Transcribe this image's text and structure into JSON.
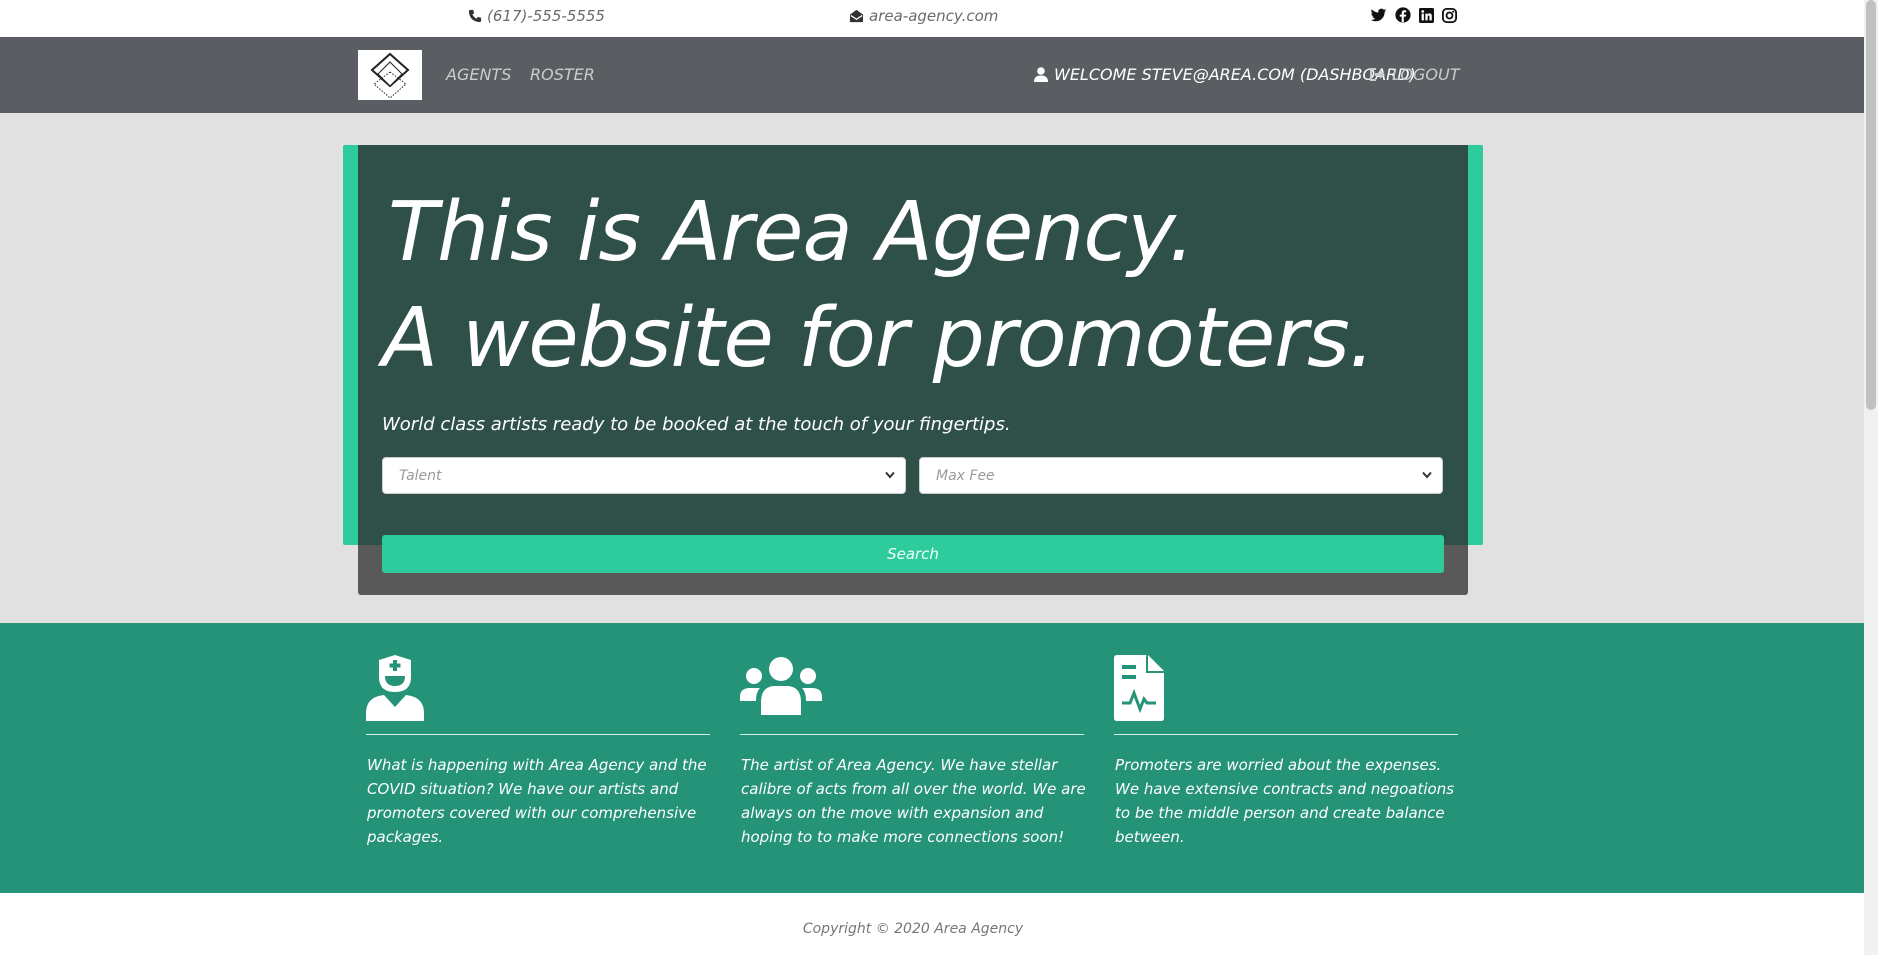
{
  "topbar": {
    "phone": "(617)-555-5555",
    "email": "area-agency.com",
    "social": [
      "twitter-icon",
      "facebook-icon",
      "linkedin-icon",
      "instagram-icon"
    ]
  },
  "nav": {
    "links": [
      "AGENTS",
      "ROSTER"
    ],
    "welcome": "WELCOME STEVE@AREA.COM (DASHBOARD)",
    "logout": "LOGOUT"
  },
  "hero": {
    "headline_line1": "This is Area Agency.",
    "headline_line2": "A website for promoters.",
    "tagline": "World class artists ready to be booked at the touch of your fingertips.",
    "talent_placeholder": "Talent",
    "maxfee_placeholder": "Max Fee",
    "search_label": "Search"
  },
  "features": [
    {
      "icon": "nurse-icon",
      "text": "What is happening with Area Agency and the COVID situation? We have our artists and promoters covered with our comprehensive packages."
    },
    {
      "icon": "users-icon",
      "text": "The artist of Area Agency. We have stellar calibre of acts from all over the world. We are always on the move with expansion and hoping to to make more connections soon!"
    },
    {
      "icon": "file-medical-icon",
      "text": "Promoters are worried about the expenses. We have extensive contracts and negoations to be the middle person and create balance between."
    }
  ],
  "footer": {
    "copyright": "Copyright © 2020 Area Agency"
  },
  "colors": {
    "accent": "#2ecc9d",
    "feature_bg": "#249377",
    "hero_panel": "#2f5048",
    "nav_bg": "#5a5e62"
  }
}
